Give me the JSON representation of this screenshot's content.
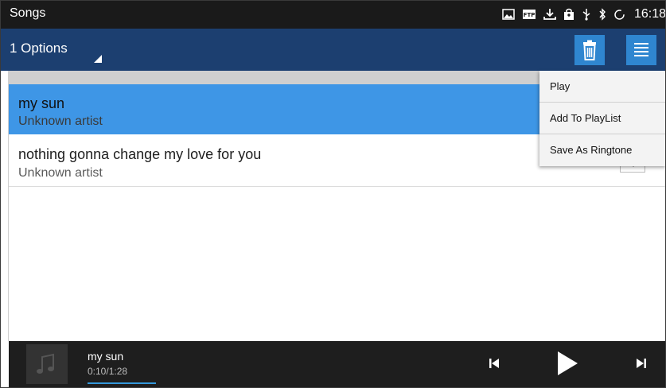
{
  "statusbar": {
    "title": "Songs",
    "clock": "16:18",
    "icons": [
      "image-icon",
      "ftp-icon",
      "download-icon",
      "shopping-bag-icon",
      "usb-icon",
      "bluetooth-icon",
      "sync-icon"
    ]
  },
  "actionbar": {
    "options_label": "1 Options",
    "delete_icon": "trash-icon",
    "menu_icon": "menu-icon",
    "button_color": "#2f86d0",
    "bar_color": "#1c3f70"
  },
  "songs": [
    {
      "title": "my sun",
      "artist": "Unknown artist",
      "selected": true
    },
    {
      "title": "nothing gonna change my love for you",
      "artist": "Unknown artist",
      "selected": false
    }
  ],
  "menu": {
    "items": [
      "Play",
      "Add To PlayList",
      "Save As Ringtone"
    ]
  },
  "player": {
    "title": "my sun",
    "time": "0:10/1:28",
    "progress_fraction": 0.11
  },
  "colors": {
    "selection": "#3e96e6",
    "accent": "#3498db"
  }
}
